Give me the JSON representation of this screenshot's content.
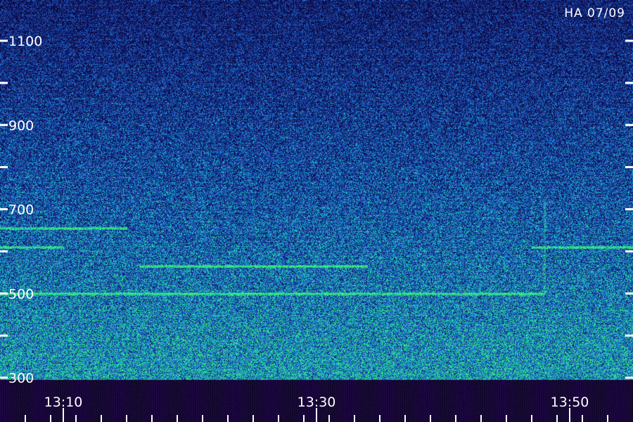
{
  "station_label": "HA 07/09",
  "colors": {
    "background_top": "#101060",
    "background_mid": "#1a3aa0",
    "signal_low": "#1f6fd6",
    "signal_mid": "#18c6c6",
    "signal_high": "#3cf06a",
    "footer": "#0c0620",
    "axis": "#ffffff"
  },
  "chart_data": {
    "type": "heatmap",
    "title": "",
    "xlabel": "",
    "ylabel": "",
    "xlim": [
      "13:05",
      "13:55"
    ],
    "ylim": [
      300,
      1200
    ],
    "y_tick_labels": [
      {
        "value": 1100,
        "label": "1100"
      },
      {
        "value": 900,
        "label": "900"
      },
      {
        "value": 700,
        "label": "700"
      },
      {
        "value": 500,
        "label": "500"
      },
      {
        "value": 300,
        "label": "300"
      }
    ],
    "y_minor_ticks": [
      1000,
      800,
      600,
      400
    ],
    "x_tick_labels": [
      {
        "value": "13:10",
        "label": "13:10"
      },
      {
        "value": "13:30",
        "label": "13:30"
      },
      {
        "value": "13:50",
        "label": "13:50"
      }
    ],
    "x_minor_tick_minutes": [
      2,
      4,
      6,
      8,
      10,
      12,
      14,
      16,
      18,
      20,
      22,
      24,
      26,
      28,
      30,
      32,
      34,
      36,
      38,
      40,
      42,
      44,
      46,
      48,
      50,
      52,
      54,
      56
    ],
    "series": [
      {
        "value": 500,
        "x_range": [
          "13:05",
          "13:48"
        ]
      },
      {
        "value": 565,
        "x_range": [
          "13:16",
          "13:34"
        ]
      },
      {
        "value": 610,
        "x_range": [
          "13:05",
          "13:10"
        ]
      },
      {
        "value": 610,
        "x_range": [
          "13:47",
          "13:55"
        ]
      },
      {
        "value": 655,
        "x_range": [
          "13:05",
          "13:15"
        ]
      }
    ],
    "vertical_features": [
      {
        "time": "13:48",
        "freq_range": [
          500,
          720
        ]
      }
    ]
  }
}
